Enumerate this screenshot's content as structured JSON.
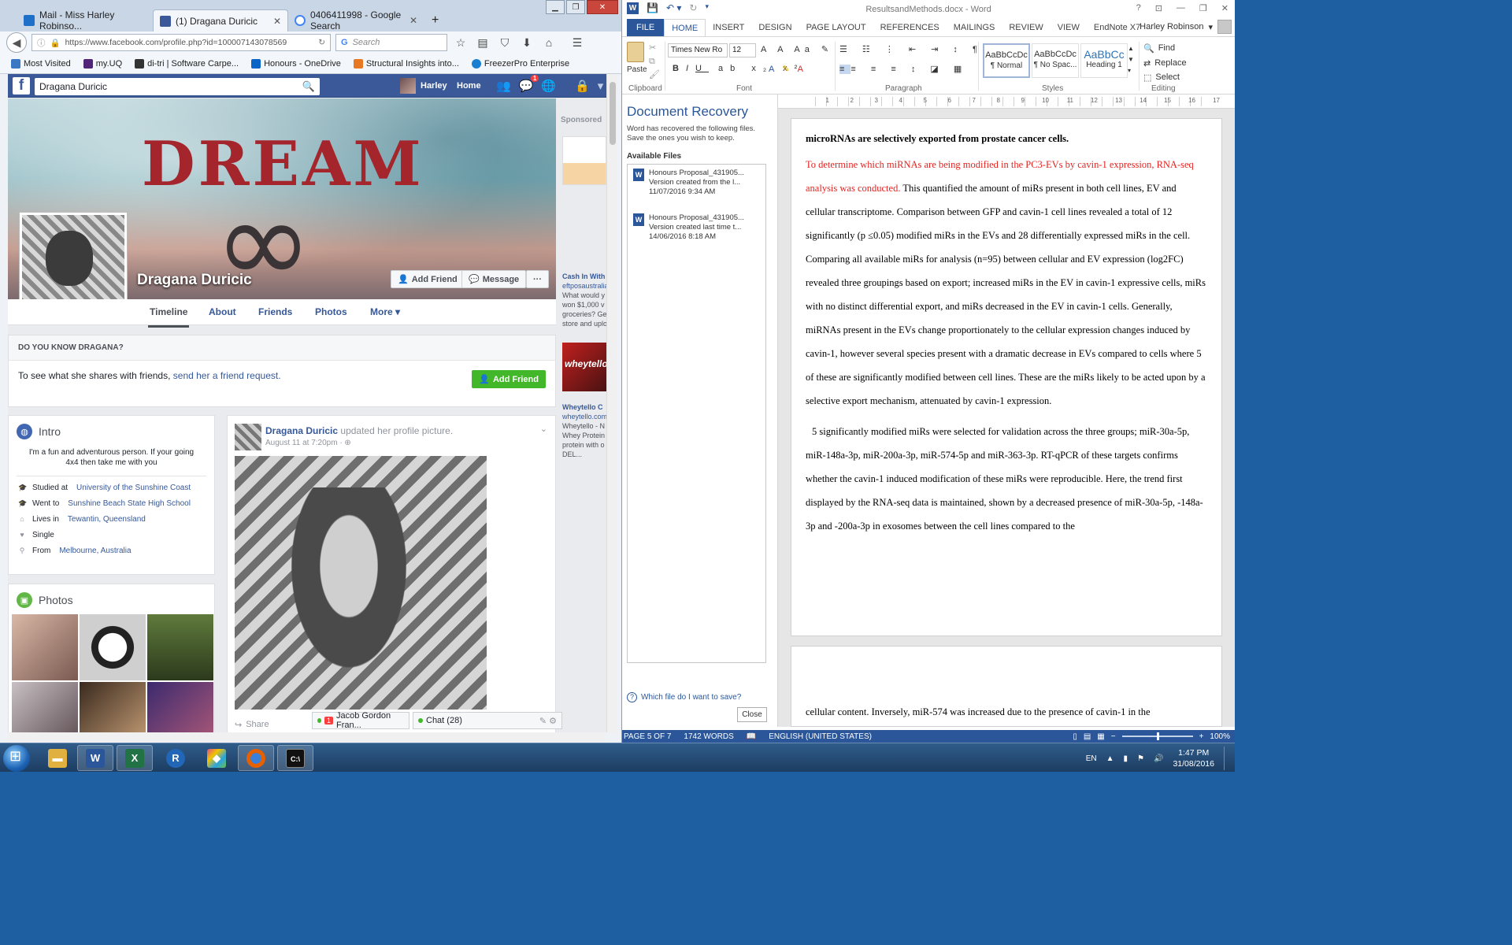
{
  "firefox": {
    "tabs": [
      {
        "title": "Mail - Miss Harley Robinso...",
        "icon_color": "#1e6fc8",
        "active": false
      },
      {
        "title": "(1) Dragana Duricic",
        "icon_color": "#3b5998",
        "active": true
      },
      {
        "title": "0406411998 - Google Search",
        "icon_color": "#4285f4",
        "active": false
      }
    ],
    "new_tab": "+",
    "url": "https://www.facebook.com/profile.php?id=100007143078569",
    "search_placeholder": "Search",
    "bookmarks": [
      {
        "label": "Most Visited",
        "icon_color": "#3b78c3"
      },
      {
        "label": "my.UQ",
        "icon_color": "#51247a"
      },
      {
        "label": "di-tri | Software Carpe...",
        "icon_color": "#333333"
      },
      {
        "label": "Honours - OneDrive",
        "icon_color": "#0a64c8"
      },
      {
        "label": "Structural Insights into...",
        "icon_color": "#e87722"
      },
      {
        "label": "FreezerPro Enterprise",
        "icon_color": "#1a7fd1"
      }
    ]
  },
  "facebook": {
    "search_value": "Dragana Duricic",
    "user_name": "Harley",
    "home": "Home",
    "notif_count": "1",
    "cover_word": "DREAM",
    "cover_symbol": "∞",
    "profile_name": "Dragana Duricic",
    "add_friend": "Add Friend",
    "message": "Message",
    "more_dots": "···",
    "tabs": [
      "Timeline",
      "About",
      "Friends",
      "Photos",
      "More ▾"
    ],
    "know_heading": "DO YOU KNOW DRAGANA?",
    "know_text": "To see what she shares with friends,",
    "know_link": "send her a friend request.",
    "know_button": "Add Friend",
    "intro": {
      "title": "Intro",
      "bio": "I'm a fun and adventurous person. If your going 4x4 then take me with you",
      "rows": [
        {
          "icon": "🎓",
          "text": "Studied at",
          "link": "University of the Sunshine Coast"
        },
        {
          "icon": "🎓",
          "text": "Went to",
          "link": "Sunshine Beach State High School"
        },
        {
          "icon": "⌂",
          "text": "Lives in",
          "link": "Tewantin, Queensland"
        },
        {
          "icon": "♥",
          "text": "Single",
          "link": ""
        },
        {
          "icon": "⚲",
          "text": "From",
          "link": "Melbourne, Australia"
        }
      ]
    },
    "photos_title": "Photos",
    "photo_colors": [
      "#7a5a52",
      "#cfcfcf",
      "#3d5a2c",
      "#5a4a4e",
      "#8a6a4e",
      "#b05a78"
    ],
    "post": {
      "author": "Dragana Duricic",
      "action": "updated her profile picture.",
      "time": "August 11 at 7:20pm · ⊕",
      "share": "Share"
    },
    "chat_contact": "Jacob Gordon Fran...",
    "chat_contact_badge": "1",
    "chat_label": "Chat (28)",
    "sponsored": {
      "label": "Sponsored",
      "ad1_title": "Cash In With",
      "ad1_domain": "eftposaustralia",
      "ad1_lines": [
        "What would y",
        "won $1,000 v",
        "groceries? Ge",
        "store and uplo"
      ],
      "ad2_image_text": "wheytello",
      "ad2_title": "Wheytello C",
      "ad2_domain": "wheytello.com",
      "ad2_lines": [
        "Wheytello - N",
        "Whey Protein",
        "protein with o",
        "DEL..."
      ]
    }
  },
  "word": {
    "title": "ResultsandMethods.docx - Word",
    "ribbon_tabs": [
      "FILE",
      "HOME",
      "INSERT",
      "DESIGN",
      "PAGE LAYOUT",
      "REFERENCES",
      "MAILINGS",
      "REVIEW",
      "VIEW",
      "EndNote X7"
    ],
    "user": "Harley Robinson",
    "paste": "Paste",
    "clipboard": "Clipboard",
    "font_name": "Times New Ro",
    "font_size": "12",
    "font_group": "Font",
    "paragraph_group": "Paragraph",
    "styles_group": "Styles",
    "editing_group": "Editing",
    "styles": [
      {
        "preview": "AaBbCcDc",
        "name": "¶ Normal"
      },
      {
        "preview": "AaBbCcDc",
        "name": "¶ No Spac..."
      },
      {
        "preview": "AaBbCc",
        "name": "Heading 1"
      }
    ],
    "editing": [
      "Find",
      "Replace",
      "Select"
    ],
    "recovery": {
      "title": "Document Recovery",
      "desc": "Word has recovered the following files. Save the ones you wish to keep.",
      "available": "Available Files",
      "files": [
        {
          "name": "Honours Proposal_431905...",
          "line2": "Version created from the l...",
          "date": "11/07/2016 9:34 AM"
        },
        {
          "name": "Honours Proposal_431905...",
          "line2": "Version created last time t...",
          "date": "14/06/2016 8:18 AM"
        }
      ],
      "help": "Which file do I want to save?",
      "close": "Close"
    },
    "doc": {
      "heading": "microRNAs are selectively exported from prostate cancer cells.",
      "p1_red": "To determine which miRNAs are being modified in the PC3-EVs by cavin-1 expression, RNA-seq analysis was conducted.",
      "p1_rest": " This quantified the amount of miRs present in both cell lines, EV and cellular transcriptome. Comparison between GFP and cavin-1 cell lines revealed a total of 12 significantly (p ≤0.05) modified miRs in the EVs and 28 differentially expressed miRs in the cell. Comparing all available miRs for analysis (n=95) between cellular and EV expression (log2FC) revealed three groupings based on export; increased miRs in the EV in cavin-1 expressive cells, miRs with no distinct differential export, and miRs decreased in the EV in cavin-1 cells. Generally, miRNAs present in the EVs change proportionately to the cellular expression changes induced by cavin-1, however several species present with a dramatic decrease in EVs compared to cells where 5 of these are significantly modified between cell lines. These are the miRs likely to be acted upon by a selective export mechanism, attenuated by cavin-1 expression.",
      "p2": "5 significantly modified miRs were selected for validation across the three groups; miR-30a-5p, miR-148a-3p, miR-200a-3p, miR-574-5p and miR-363-3p. RT-qPCR of these targets confirms whether the cavin-1 induced modification of these miRs were reproducible. Here, the trend first displayed by the RNA-seq data is maintained, shown by a decreased presence of miR-30a-5p, -148a-3p and -200a-3p in exosomes between the cell lines compared to the",
      "page2_text": "cellular content. Inversely, miR-574 was increased due to the presence of cavin-1 in the"
    },
    "status": {
      "page": "PAGE 5 OF 7",
      "words": "1742 WORDS",
      "language": "ENGLISH (UNITED STATES)",
      "zoom": "100%"
    },
    "ruler_numbers": [
      "1",
      "2",
      "3",
      "4",
      "5",
      "6",
      "7",
      "8",
      "9",
      "10",
      "11",
      "12",
      "13",
      "14",
      "15",
      "16",
      "17"
    ]
  },
  "taskbar": {
    "apps": [
      {
        "name": "explorer",
        "label": "📁",
        "color": "#e0b040",
        "open": false
      },
      {
        "name": "word",
        "label": "W",
        "color": "#2b579a",
        "open": true
      },
      {
        "name": "excel",
        "label": "X",
        "color": "#217346",
        "open": true
      },
      {
        "name": "r",
        "label": "R",
        "color": "#2266b8",
        "open": false
      },
      {
        "name": "pinwheel",
        "label": "◈",
        "color": "#e04b8a",
        "open": false
      },
      {
        "name": "firefox",
        "label": "◉",
        "color": "#e66000",
        "open": true
      },
      {
        "name": "cmd",
        "label": "C:\\",
        "color": "#111111",
        "open": true
      }
    ],
    "lang": "EN",
    "time": "1:47 PM",
    "date": "31/08/2016"
  }
}
